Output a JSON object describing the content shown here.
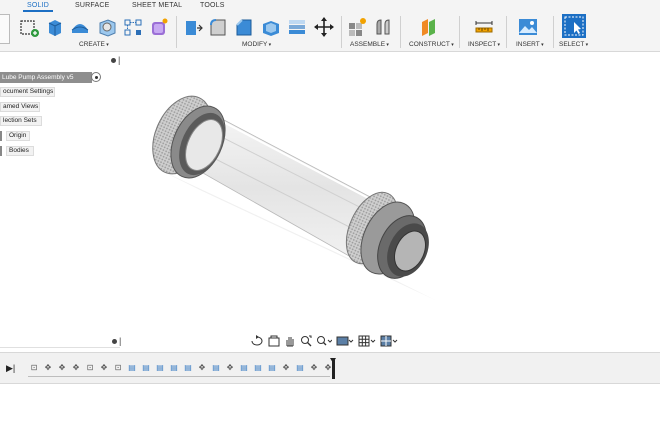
{
  "toolbar": {
    "tabs": [
      {
        "label": "SOLID",
        "active": true
      },
      {
        "label": "SURFACE",
        "active": false
      },
      {
        "label": "SHEET METAL",
        "active": false
      },
      {
        "label": "TOOLS",
        "active": false
      }
    ],
    "groups": {
      "create": "CREATE",
      "modify": "MODIFY",
      "assemble": "ASSEMBLE",
      "construct": "CONSTRUCT",
      "inspect": "INSPECT",
      "insert": "INSERT",
      "select": "SELECT"
    },
    "accent_color": "#1c6fc4"
  },
  "browser": {
    "root": "Lube Pump Assembly v5",
    "items": [
      {
        "label": "ocument Settings"
      },
      {
        "label": "amed Views"
      },
      {
        "label": "lection Sets"
      },
      {
        "label": "Origin"
      },
      {
        "label": "Bodies"
      }
    ]
  },
  "navbar": {
    "icons": [
      "orbit-icon",
      "look-at-icon",
      "pan-icon",
      "zoom-window-icon",
      "zoom-icon",
      "display-settings-icon",
      "grid-icon",
      "viewports-icon"
    ]
  },
  "timeline": {
    "play_icon": "play-icon",
    "items": [
      {
        "glyph": "⊡",
        "type": "sketch"
      },
      {
        "glyph": "✥",
        "type": "move"
      },
      {
        "glyph": "✥",
        "type": "move"
      },
      {
        "glyph": "✥",
        "type": "move"
      },
      {
        "glyph": "⊡",
        "type": "sketch"
      },
      {
        "glyph": "✥",
        "type": "move"
      },
      {
        "glyph": "⊡",
        "type": "sketch"
      },
      {
        "glyph": "▤",
        "type": "body"
      },
      {
        "glyph": "▤",
        "type": "body"
      },
      {
        "glyph": "▤",
        "type": "body"
      },
      {
        "glyph": "▤",
        "type": "body"
      },
      {
        "glyph": "▤",
        "type": "body"
      },
      {
        "glyph": "✥",
        "type": "move"
      },
      {
        "glyph": "▤",
        "type": "body"
      },
      {
        "glyph": "✥",
        "type": "move"
      },
      {
        "glyph": "▤",
        "type": "body"
      },
      {
        "glyph": "▤",
        "type": "body"
      },
      {
        "glyph": "▤",
        "type": "body"
      },
      {
        "glyph": "✥",
        "type": "move"
      },
      {
        "glyph": "▤",
        "type": "body"
      },
      {
        "glyph": "✥",
        "type": "move"
      },
      {
        "glyph": "✥",
        "type": "move"
      }
    ]
  }
}
